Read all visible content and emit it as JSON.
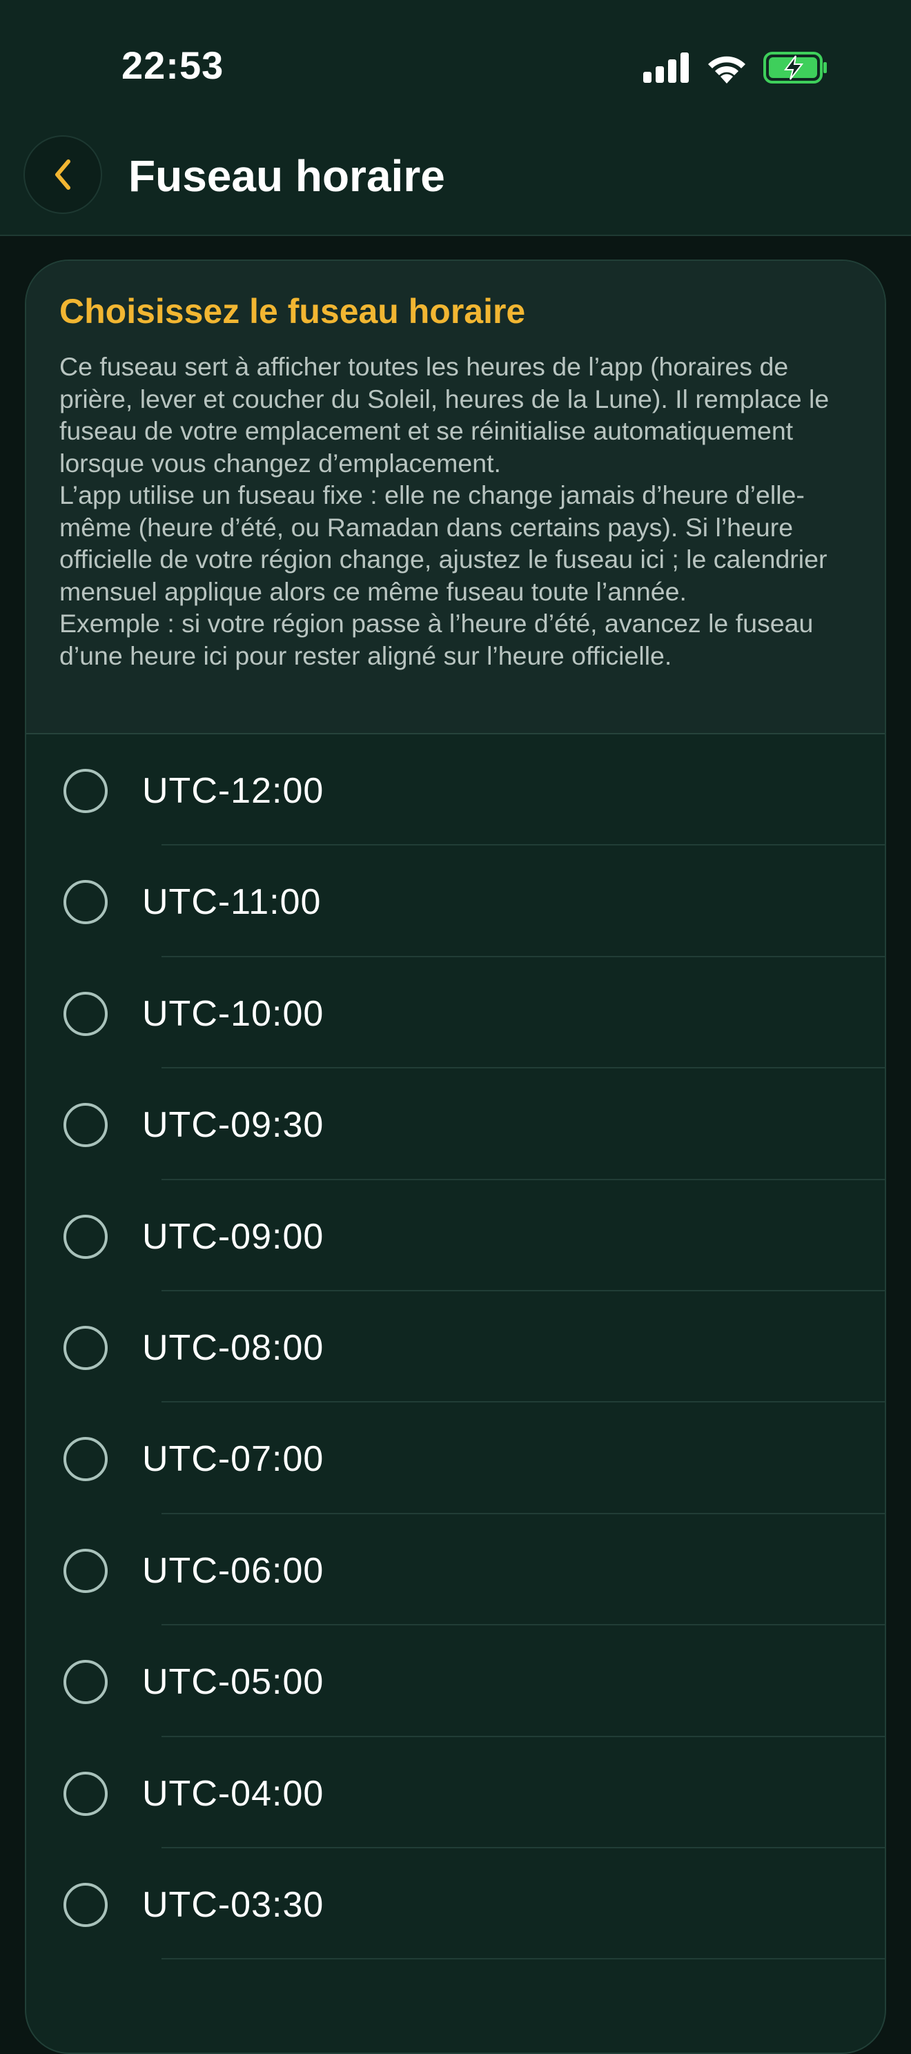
{
  "status_bar": {
    "time": "22:53",
    "icons": [
      "cellular-signal-icon",
      "wifi-icon",
      "battery-charging-icon"
    ]
  },
  "nav": {
    "back_icon": "chevron-left-icon",
    "title": "Fuseau horaire"
  },
  "card": {
    "title": "Choisissez le fuseau horaire",
    "description": "Ce fuseau sert à afficher toutes les heures de l’app (horaires de prière, lever et coucher du Soleil, heures de la Lune). Il remplace le fuseau de votre emplacement et se réinitialise automatiquement lorsque vous changez d’emplacement.\nL’app utilise un fuseau fixe : elle ne change jamais d’heure d’elle-même (heure d’été, ou Ramadan dans certains pays). Si l’heure officielle de votre région change, ajustez le fuseau ici ; le calendrier mensuel applique alors ce même fuseau toute l’année.\nExemple : si votre région passe à l’heure d’été, avancez le fuseau d’une heure ici pour rester aligné sur l’heure officielle."
  },
  "timezones": [
    "UTC-12:00",
    "UTC-11:00",
    "UTC-10:00",
    "UTC-09:30",
    "UTC-09:00",
    "UTC-08:00",
    "UTC-07:00",
    "UTC-06:00",
    "UTC-05:00",
    "UTC-04:00",
    "UTC-03:30"
  ],
  "colors": {
    "accent": "#f2b632",
    "background": "#0f2620",
    "battery": "#3ecf5b"
  }
}
